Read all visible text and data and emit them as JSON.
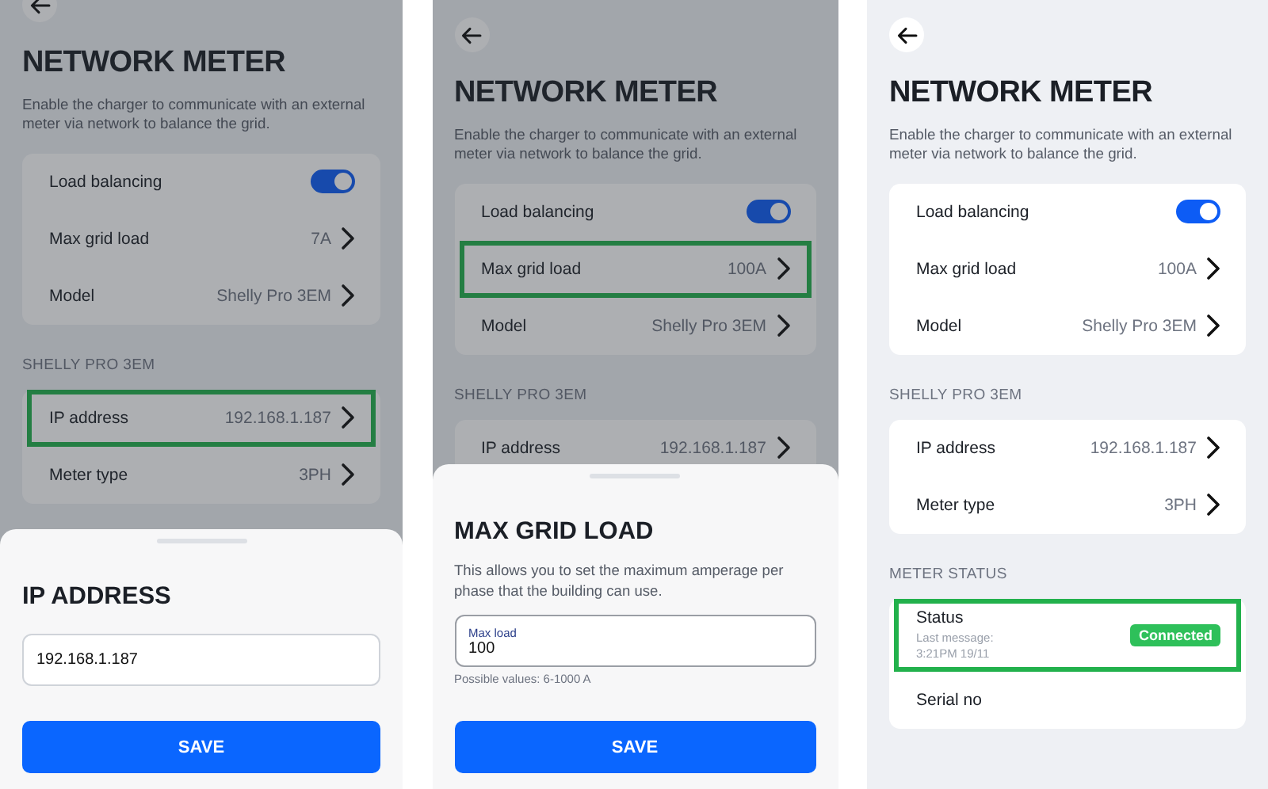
{
  "screens": [
    {
      "dimmed": true,
      "title": "NETWORK METER",
      "description": "Enable the charger to communicate with an external meter via network to balance the grid.",
      "groups": [
        {
          "rows": [
            {
              "kind": "toggle",
              "label": "Load balancing",
              "on": true,
              "highlighted": false
            },
            {
              "kind": "nav",
              "label": "Max grid load",
              "value": "7A",
              "highlighted": false
            },
            {
              "kind": "nav",
              "label": "Model",
              "value": "Shelly Pro 3EM",
              "highlighted": false
            }
          ]
        },
        {
          "header": "SHELLY PRO 3EM",
          "rows": [
            {
              "kind": "nav",
              "label": "IP address",
              "value": "192.168.1.187",
              "highlighted": true
            },
            {
              "kind": "nav",
              "label": "Meter type",
              "value": "3PH",
              "highlighted": false
            }
          ]
        }
      ],
      "sheet": {
        "title": "IP ADDRESS",
        "field": {
          "value": "192.168.1.187"
        },
        "button": "SAVE"
      }
    },
    {
      "dimmed": true,
      "title": "NETWORK METER",
      "description": "Enable the charger to communicate with an external meter via network to balance the grid.",
      "groups": [
        {
          "rows": [
            {
              "kind": "toggle",
              "label": "Load balancing",
              "on": true,
              "highlighted": false
            },
            {
              "kind": "nav",
              "label": "Max grid load",
              "value": "100A",
              "highlighted": true
            },
            {
              "kind": "nav",
              "label": "Model",
              "value": "Shelly Pro 3EM",
              "highlighted": false
            }
          ]
        },
        {
          "header": "SHELLY PRO 3EM",
          "rows": [
            {
              "kind": "nav",
              "label": "IP address",
              "value": "192.168.1.187",
              "highlighted": false
            }
          ]
        }
      ],
      "sheet": {
        "title": "MAX GRID LOAD",
        "description": "This allows you to set the maximum amperage per phase that the building can use.",
        "field": {
          "label": "Max load",
          "value": "100",
          "helper": "Possible values: 6-1000 A"
        },
        "button": "SAVE"
      }
    },
    {
      "dimmed": false,
      "title": "NETWORK METER",
      "description": "Enable the charger to communicate with an external meter via network to balance the grid.",
      "groups": [
        {
          "rows": [
            {
              "kind": "toggle",
              "label": "Load balancing",
              "on": true,
              "highlighted": false
            },
            {
              "kind": "nav",
              "label": "Max grid load",
              "value": "100A",
              "highlighted": false
            },
            {
              "kind": "nav",
              "label": "Model",
              "value": "Shelly Pro 3EM",
              "highlighted": false
            }
          ]
        },
        {
          "header": "SHELLY PRO 3EM",
          "rows": [
            {
              "kind": "nav",
              "label": "IP address",
              "value": "192.168.1.187",
              "highlighted": false
            },
            {
              "kind": "nav",
              "label": "Meter type",
              "value": "3PH",
              "highlighted": false
            }
          ]
        },
        {
          "header": "METER STATUS",
          "rows": [
            {
              "kind": "status",
              "label": "Status",
              "detail": "Last message: 3:21PM 19/11",
              "badge": "Connected",
              "highlighted": true
            },
            {
              "kind": "info",
              "label": "Serial no",
              "highlighted": false
            }
          ]
        }
      ]
    }
  ]
}
